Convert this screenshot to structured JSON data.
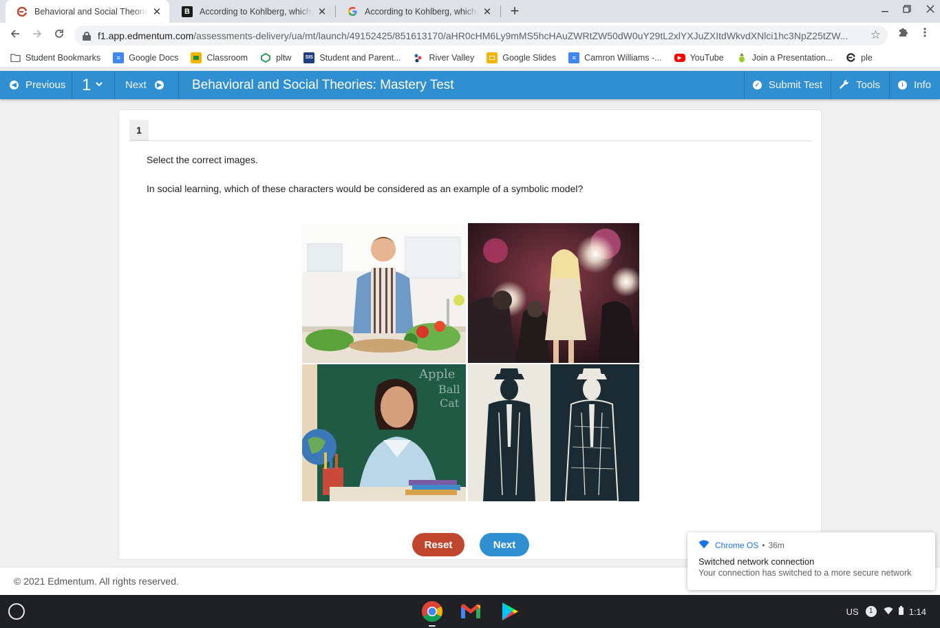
{
  "browser": {
    "tabs": [
      {
        "title": "Behavioral and Social Theories: M",
        "favicon": "edmentum-icon",
        "active": true
      },
      {
        "title": "According to Kohlberg, which sta",
        "favicon": "brainly-icon",
        "active": false
      },
      {
        "title": "According to Kohlberg, which sta",
        "favicon": "google-icon",
        "active": false
      }
    ],
    "new_tab": "+",
    "url_host": "f1.app.edmentum.com",
    "url_path": "/assessments-delivery/ua/mt/launch/49152425/851613170/aHR0cHM6Ly9mMS5hcHAuZWRtZW50dW0uY29tL2xlYXJuZXItdWkvdXNlci1hc3NpZ25tZW..."
  },
  "bookmarks": [
    {
      "label": "Student Bookmarks",
      "icon": "folder-icon"
    },
    {
      "label": "Google Docs",
      "icon": "docs-icon"
    },
    {
      "label": "Classroom",
      "icon": "classroom-icon"
    },
    {
      "label": "pltw",
      "icon": "pltw-icon"
    },
    {
      "label": "Student and Parent...",
      "icon": "sis-icon"
    },
    {
      "label": "River Valley",
      "icon": "rivervalley-icon"
    },
    {
      "label": "Google Slides",
      "icon": "slides-icon"
    },
    {
      "label": "Camron Williams -...",
      "icon": "docs-icon"
    },
    {
      "label": "YouTube",
      "icon": "youtube-icon"
    },
    {
      "label": "Join a Presentation...",
      "icon": "presentation-icon"
    },
    {
      "label": "ple",
      "icon": "edmentum-icon"
    }
  ],
  "edbar": {
    "previous": "Previous",
    "question_number": "1",
    "next": "Next",
    "title": "Behavioral and Social Theories: Mastery Test",
    "submit": "Submit Test",
    "tools": "Tools",
    "info": "Info",
    "accent": "#2f8fd1"
  },
  "question": {
    "tab": "1",
    "instruction": "Select the correct images.",
    "text": "In social learning, which of these characters would be considered as an example of a symbolic model?",
    "images": [
      {
        "name": "man-cooking-image",
        "description": "Man cooking vegetables in kitchen"
      },
      {
        "name": "celebrity-photographers-image",
        "description": "Celebrity with paparazzi"
      },
      {
        "name": "teacher-image",
        "description": "Smiling teacher at chalkboard"
      },
      {
        "name": "comic-character-image",
        "description": "Illustrated noir detective figures"
      }
    ],
    "reset": "Reset",
    "next": "Next"
  },
  "footer": {
    "copyright": "© 2021 Edmentum. All rights reserved."
  },
  "notification": {
    "source": "Chrome OS",
    "time": "36m",
    "title": "Switched network connection",
    "body": "Your connection has switched to a more secure network"
  },
  "shelf": {
    "locale": "US",
    "badge": "1",
    "time": "1:14"
  }
}
